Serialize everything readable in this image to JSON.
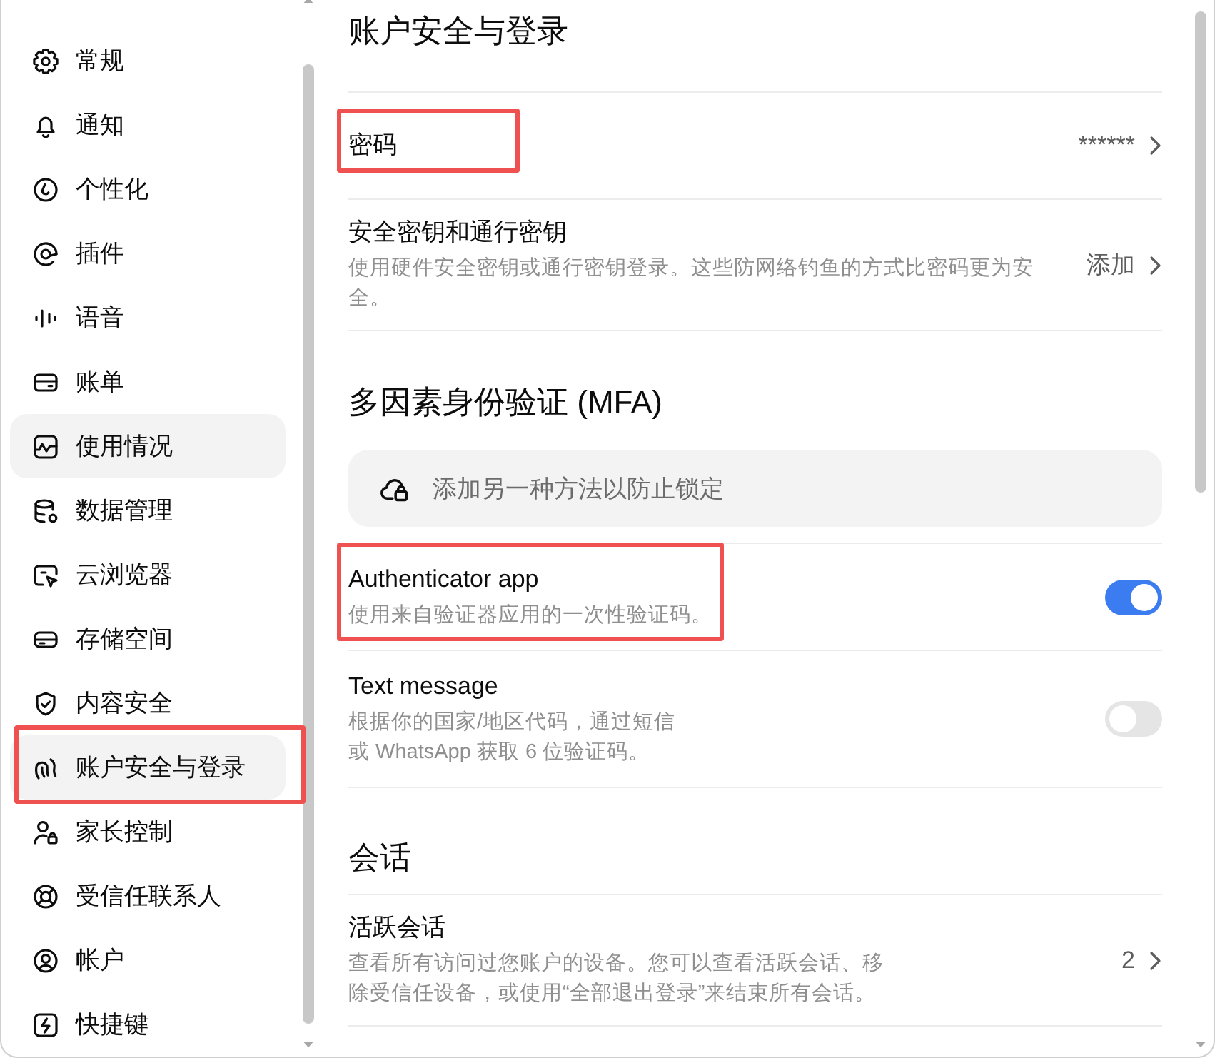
{
  "sidebar": {
    "items": [
      {
        "label": "常规",
        "selected": false,
        "highlighted": false
      },
      {
        "label": "通知",
        "selected": false,
        "highlighted": false
      },
      {
        "label": "个性化",
        "selected": false,
        "highlighted": false
      },
      {
        "label": "插件",
        "selected": false,
        "highlighted": false
      },
      {
        "label": "语音",
        "selected": false,
        "highlighted": false
      },
      {
        "label": "账单",
        "selected": false,
        "highlighted": false
      },
      {
        "label": "使用情况",
        "selected": true,
        "highlighted": false
      },
      {
        "label": "数据管理",
        "selected": false,
        "highlighted": false
      },
      {
        "label": "云浏览器",
        "selected": false,
        "highlighted": false
      },
      {
        "label": "存储空间",
        "selected": false,
        "highlighted": false
      },
      {
        "label": "内容安全",
        "selected": false,
        "highlighted": false
      },
      {
        "label": "账户安全与登录",
        "selected": true,
        "highlighted": true
      },
      {
        "label": "家长控制",
        "selected": false,
        "highlighted": false
      },
      {
        "label": "受信任联系人",
        "selected": false,
        "highlighted": false
      },
      {
        "label": "帐户",
        "selected": false,
        "highlighted": false
      },
      {
        "label": "快捷键",
        "selected": false,
        "highlighted": false
      }
    ]
  },
  "account": {
    "title": "账户安全与登录",
    "rows": [
      {
        "kind": "link",
        "label": "密码",
        "value": "******",
        "highlighted": true
      },
      {
        "kind": "link",
        "label": "安全密钥和通行密钥",
        "description": "使用硬件安全密钥或通行密钥登录。这些防网络钓鱼的方式比密码更为安全。",
        "value": "添加",
        "highlighted": false
      }
    ]
  },
  "mfa": {
    "heading": "多因素身份验证 (MFA)",
    "notice": "添加另一种方法以防止锁定",
    "methods": [
      {
        "kind": "toggle",
        "label": "Authenticator app",
        "description": "使用来自验证器应用的一次性验证码。",
        "on": true,
        "highlighted": true
      },
      {
        "kind": "toggle",
        "label": "Text message",
        "description": "根据你的国家/地区代码，通过短信或 WhatsApp 获取 6 位验证码。",
        "on": false,
        "highlighted": false
      }
    ]
  },
  "sessions": {
    "heading": "会话",
    "rows": [
      {
        "kind": "link",
        "label": "活跃会话",
        "description": "查看所有访问过您账户的设备。您可以查看活跃会话、移除受信任设备，或使用“全部退出登录”来结束所有会话。",
        "value": "2",
        "highlighted": false
      }
    ]
  }
}
